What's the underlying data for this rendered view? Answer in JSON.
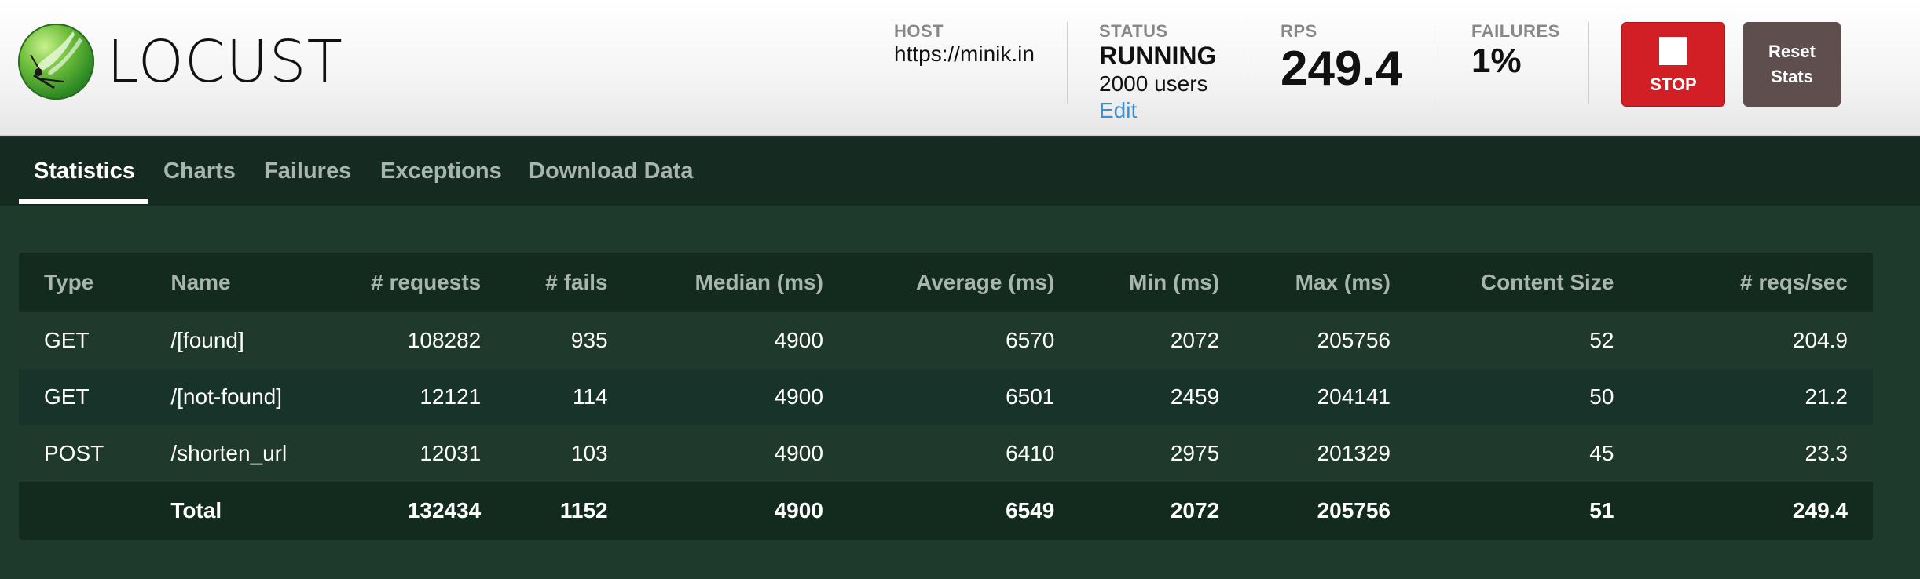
{
  "brand": {
    "name": "LOCUST"
  },
  "header": {
    "host": {
      "label": "HOST",
      "value": "https://minik.in"
    },
    "status": {
      "label": "STATUS",
      "value": "RUNNING",
      "users": "2000 users",
      "edit": "Edit"
    },
    "rps": {
      "label": "RPS",
      "value": "249.4"
    },
    "failures": {
      "label": "FAILURES",
      "value": "1%"
    },
    "stop_label": "STOP",
    "reset_label_line1": "Reset",
    "reset_label_line2": "Stats"
  },
  "tabs": [
    {
      "label": "Statistics",
      "active": true
    },
    {
      "label": "Charts"
    },
    {
      "label": "Failures"
    },
    {
      "label": "Exceptions"
    },
    {
      "label": "Download Data"
    }
  ],
  "table": {
    "columns": [
      "Type",
      "Name",
      "# requests",
      "# fails",
      "Median (ms)",
      "Average (ms)",
      "Min (ms)",
      "Max (ms)",
      "Content Size",
      "# reqs/sec"
    ],
    "rows": [
      [
        "GET",
        "/[found]",
        "108282",
        "935",
        "4900",
        "6570",
        "2072",
        "205756",
        "52",
        "204.9"
      ],
      [
        "GET",
        "/[not-found]",
        "12121",
        "114",
        "4900",
        "6501",
        "2459",
        "204141",
        "50",
        "21.2"
      ],
      [
        "POST",
        "/shorten_url",
        "12031",
        "103",
        "4900",
        "6410",
        "2975",
        "201329",
        "45",
        "23.3"
      ]
    ],
    "total": [
      "",
      "Total",
      "132434",
      "1152",
      "4900",
      "6549",
      "2072",
      "205756",
      "51",
      "249.4"
    ]
  },
  "colors": {
    "background": "#1d3a2d",
    "nav": "#152a20",
    "stop": "#d21e25",
    "reset": "#5e4e4e",
    "link": "#3a8fd0"
  }
}
